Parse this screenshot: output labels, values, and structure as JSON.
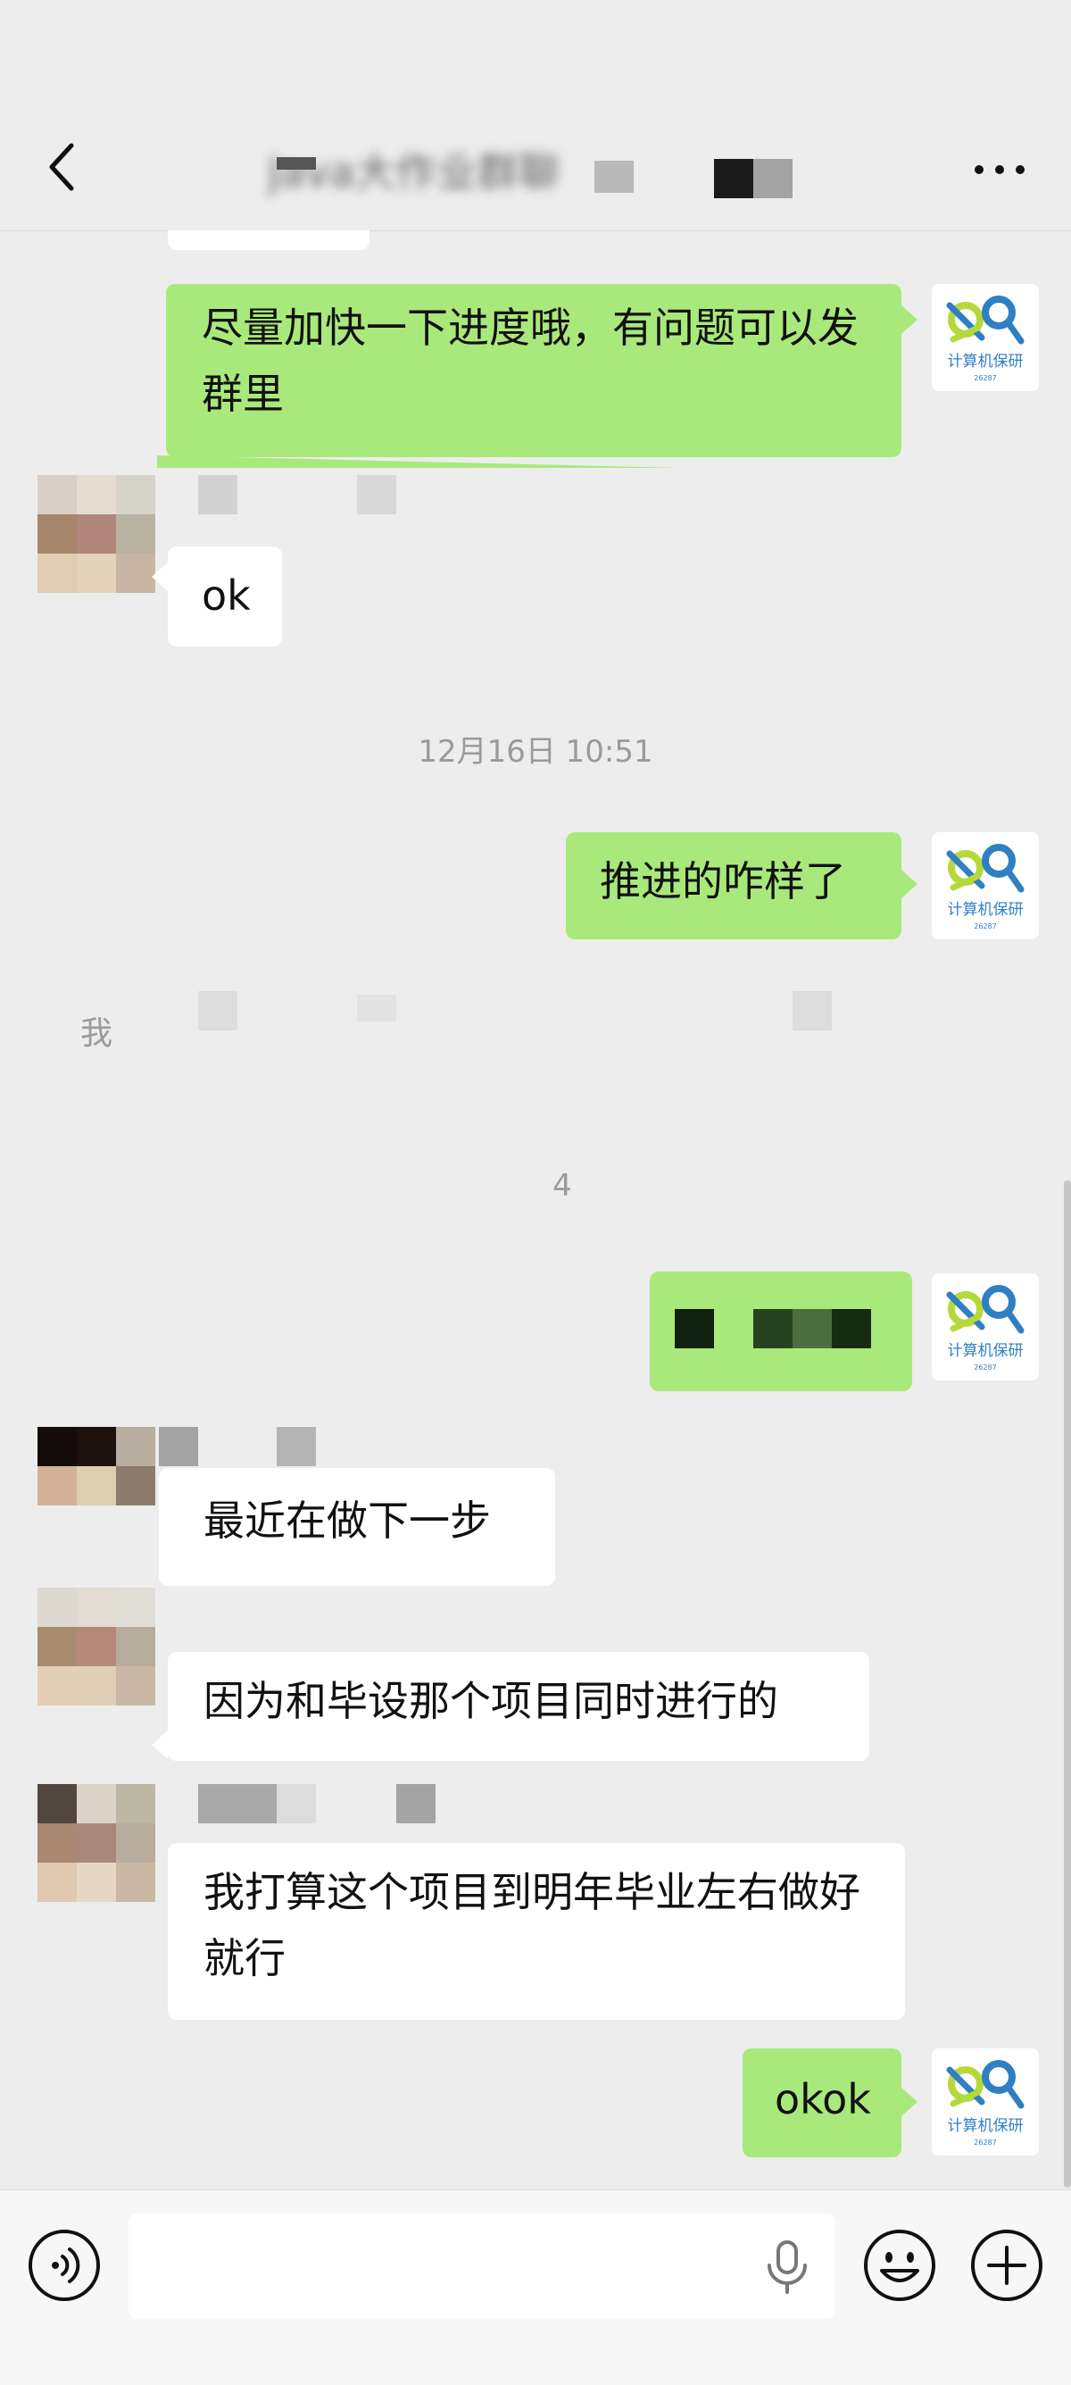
{
  "header": {
    "title": "Java大作业群聊",
    "back_icon": "chevron-left-icon",
    "more_icon": "more-horizontal-icon"
  },
  "messages": [
    {
      "id": "m1",
      "side": "sent",
      "text": "尽量加快一下进度哦，有问题可以发群里"
    },
    {
      "id": "m2",
      "side": "received",
      "text": "ok"
    },
    {
      "id": "t1",
      "side": "time",
      "text": "12月16日 10:51"
    },
    {
      "id": "m3",
      "side": "sent",
      "text": "推进的咋样了"
    },
    {
      "id": "t2",
      "side": "time",
      "text": "4"
    },
    {
      "id": "m4",
      "side": "received",
      "text": "最近在做下一步"
    },
    {
      "id": "m5",
      "side": "received",
      "text": "因为和毕设那个项目同时进行的"
    },
    {
      "id": "m6",
      "side": "received",
      "text": "我打算这个项目到明年毕业左右做好就行"
    },
    {
      "id": "m7",
      "side": "sent",
      "text": "okok"
    }
  ],
  "redacted_fragments": {
    "system_line_char": "我",
    "brand_avatar_label": "计算机保研",
    "brand_avatar_sub": "26287"
  },
  "input_bar": {
    "placeholder": "",
    "voice_icon": "voice-icon",
    "mic_icon": "microphone-icon",
    "emoji_icon": "emoji-icon",
    "plus_icon": "plus-icon"
  },
  "colors": {
    "background": "#ededed",
    "sent_bubble": "#a9e97b",
    "received_bubble": "#ffffff",
    "brand_green": "#b5d93a",
    "brand_blue": "#2f7fc3"
  }
}
